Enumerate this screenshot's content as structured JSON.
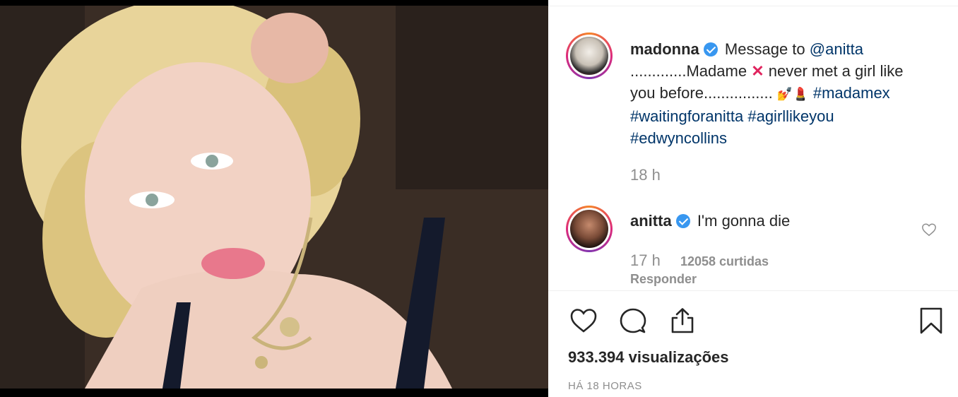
{
  "post": {
    "author": "madonna",
    "caption_intro": "Message to",
    "mention": "@anitta",
    "line2": ".............Madame",
    "line2_emoji": "✕",
    "line2_rest": "never met a girl like you before................",
    "line3_emoji": "💅💄",
    "hashtags": [
      "#madamex",
      "#waitingforanitta",
      "#agirllikeyou",
      "#edwyncollins"
    ],
    "time": "18 h"
  },
  "comment": {
    "author": "anitta",
    "text": "I'm gonna die",
    "time": "17 h",
    "likes": "12058 curtidas",
    "reply_label": "Responder"
  },
  "stats": {
    "views": "933.394 visualizações",
    "posted_ago": "HÁ 18 HORAS"
  },
  "colors": {
    "verified": "#3897f0",
    "link": "#003569",
    "muted": "#8e8e8e",
    "text": "#262626"
  },
  "icons": {
    "like": "heart-icon",
    "comment": "comment-bubble-icon",
    "share": "share-icon",
    "save": "bookmark-icon",
    "verified": "verified-badge-icon"
  }
}
